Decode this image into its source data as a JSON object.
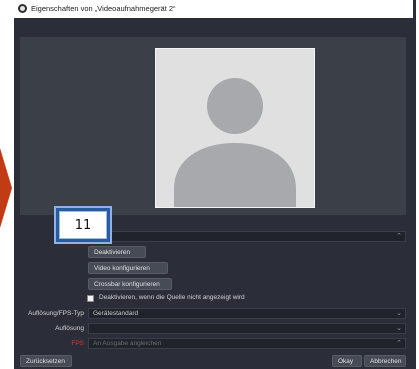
{
  "window": {
    "title": "Eigenschaften von „Videoaufnahmegerät 2“"
  },
  "device_select": {
    "value": "",
    "arrow": "⌃"
  },
  "buttons": {
    "deactivate": "Deaktivieren",
    "configure_video": "Video konfigurieren",
    "configure_crossbar": "Crossbar konfigurieren",
    "reset": "Zurücksetzen",
    "ok": "Okay",
    "cancel": "Abbrechen"
  },
  "checkbox": {
    "label": "Deaktivieren, wenn die Quelle nicht angezeigt wird",
    "checked": false
  },
  "fields": {
    "resolution_fps_type": {
      "label": "Auflösung/FPS-Typ",
      "value": "Gerätestandard"
    },
    "resolution": {
      "label": "Auflösung",
      "value": ""
    },
    "fps": {
      "label": "FPS",
      "value": "An Ausgabe angleichen"
    }
  },
  "badge": {
    "number": "11"
  },
  "colors": {
    "window_bg": "#2b2e38",
    "accent_orange": "#d84a18",
    "fps_label": "#e03030",
    "badge_blue": "#2a5aa0"
  },
  "icons": {
    "app_icon": "obs-icon",
    "preview": "user-avatar-icon",
    "dropdown": "chevron-down-icon",
    "spinner": "up-down-icon"
  }
}
